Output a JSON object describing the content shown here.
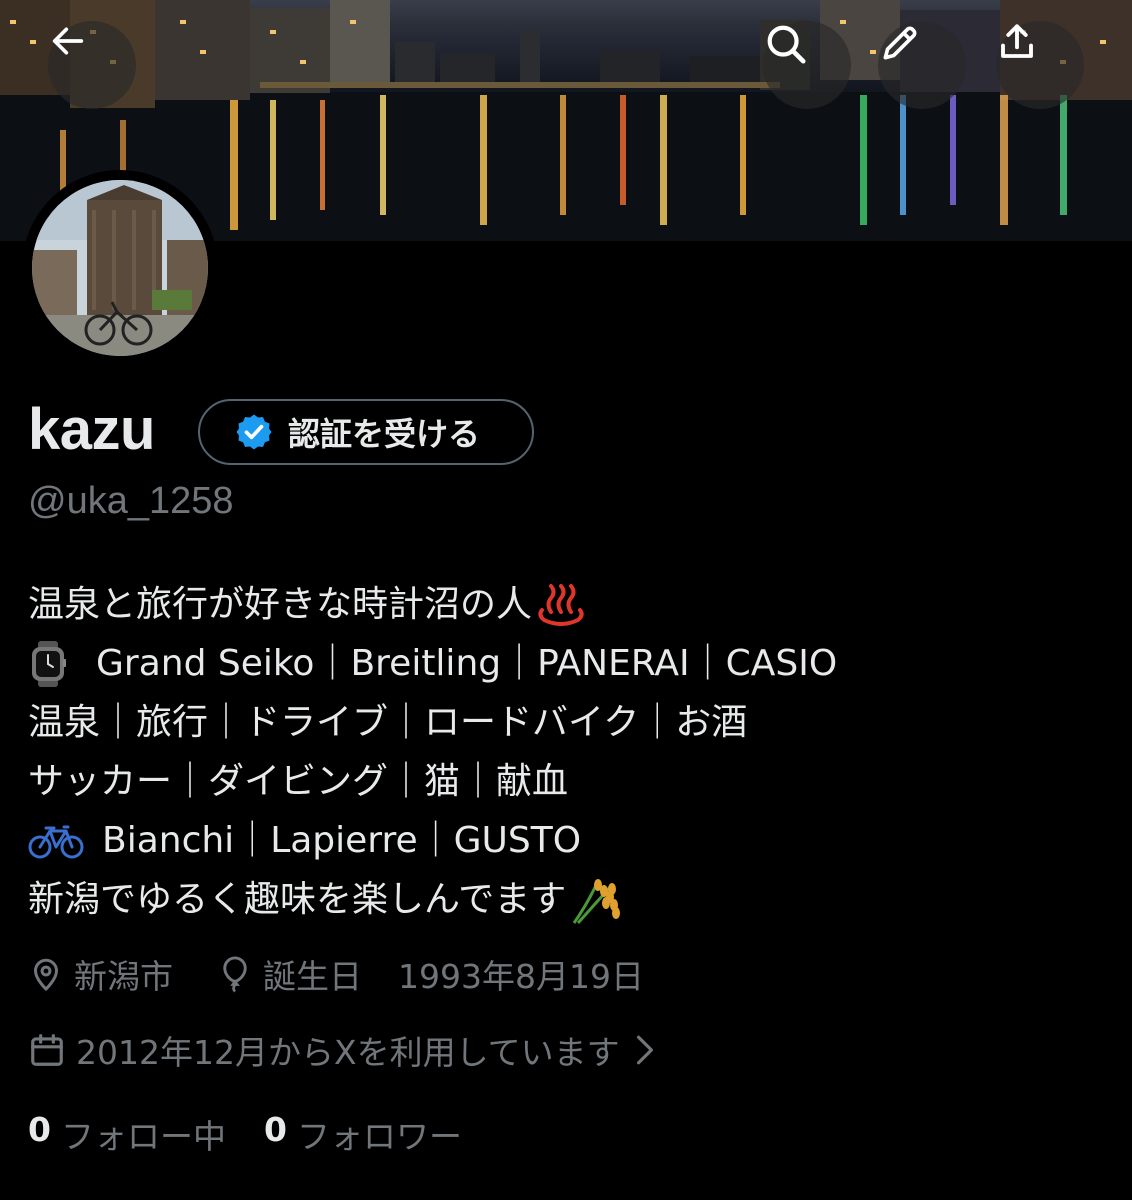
{
  "profile": {
    "name": "kazu",
    "handle": "@uka_1258",
    "verify_label": "認証を受ける"
  },
  "header": {
    "icons": [
      "back-arrow-icon",
      "search-icon",
      "pencil-icon",
      "share-icon"
    ]
  },
  "bio": {
    "line1": "温泉と旅行が好きな時計沼の人",
    "line1_emoji": "hot-springs-emoji",
    "line2": "Grand Seiko｜Breitling｜PANERAI｜CASIO",
    "line2_emoji": "watch-emoji",
    "line3": "温泉｜旅行｜ドライブ｜ロードバイク｜お酒",
    "line4": "サッカー｜ダイビング｜猫｜献血",
    "line5": "Bianchi｜Lapierre｜GUSTO",
    "line5_emoji": "bicycle-emoji",
    "line6": "新潟でゆるく趣味を楽しんでます",
    "line6_emoji": "rice-ear-emoji"
  },
  "meta": {
    "location": "新潟市",
    "birthday_label": "誕生日",
    "birthday": "1993年8月19日",
    "joined": "2012年12月からXを利用しています"
  },
  "stats": {
    "following_count": "0",
    "following_label": "フォロー中",
    "followers_count": "0",
    "followers_label": "フォロワー"
  },
  "colors": {
    "background": "#000000",
    "text": "#e7e9ea",
    "muted": "#71767b",
    "verified_blue": "#1d9bf0",
    "border": "#536471"
  }
}
